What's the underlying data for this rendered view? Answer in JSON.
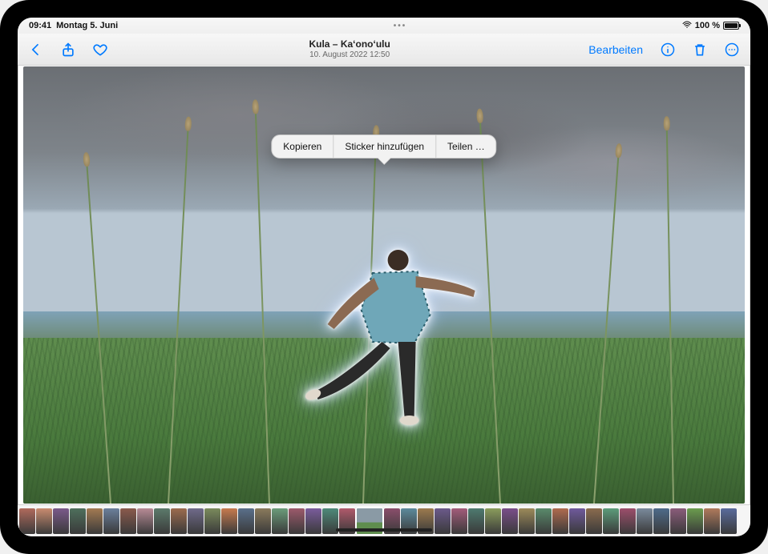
{
  "status": {
    "time": "09:41",
    "date": "Montag 5. Juni",
    "battery_text": "100 %"
  },
  "toolbar": {
    "title": "Kula – Kaʻonoʻulu",
    "subtitle": "10. August 2022 12:50",
    "edit_label": "Bearbeiten"
  },
  "popover": {
    "copy": "Kopieren",
    "add_sticker": "Sticker hinzufügen",
    "share": "Teilen …"
  },
  "icons": {
    "back": "chevron-back-icon",
    "share": "share-icon",
    "favorite": "heart-icon",
    "info": "info-icon",
    "trash": "trash-icon",
    "more": "more-icon",
    "wifi": "wifi-icon"
  },
  "colors": {
    "accent": "#007aff"
  },
  "thumbnails": {
    "count": 42,
    "selected_index": 20,
    "palette": [
      "#b06a5c",
      "#c98b6f",
      "#7a5a8a",
      "#4e6f5c",
      "#a37a52",
      "#6b7f9c",
      "#8a5a4c",
      "#b78a95",
      "#5c7a6b",
      "#9c6b4e",
      "#6f6a8a",
      "#7a8a5c",
      "#c77a4e",
      "#5a6f8a",
      "#8a7a5c",
      "#6b9c7a",
      "#9c5a6b",
      "#7a5c9c",
      "#4e8a7a",
      "#b05a6b",
      "#6f8a4e",
      "#8a4e6b",
      "#5c8a9c",
      "#9c7a4e",
      "#6b5a8a",
      "#a35c7a",
      "#4e7a6f",
      "#8a9c5c",
      "#7a4e8a",
      "#9c8a5a",
      "#5a8a6b",
      "#b06b4e",
      "#6f5a9c",
      "#8a6b4e",
      "#5c9c7a",
      "#9c4e6b",
      "#7a8a9c",
      "#4e6b8a",
      "#8a5c7a",
      "#6b9c4e",
      "#b07a5c",
      "#5a6b9c"
    ]
  }
}
